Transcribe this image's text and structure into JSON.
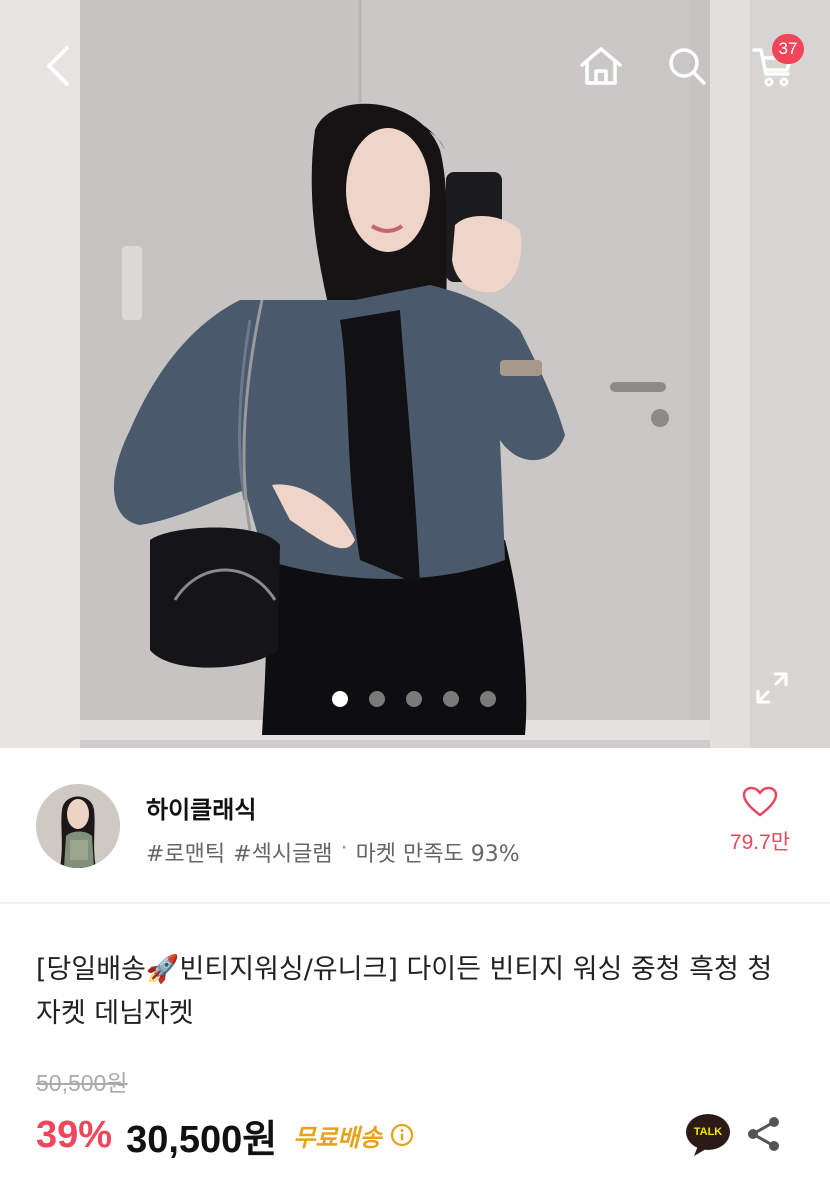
{
  "header": {
    "cart_count": "37",
    "icons": [
      "chevron-left-icon",
      "home-icon",
      "search-icon",
      "cart-icon",
      "expand-icon"
    ]
  },
  "gallery": {
    "slide_count": 5,
    "active_slide": 1
  },
  "seller": {
    "name": "하이클래식",
    "tag1": "#로맨틱",
    "tag2": "#섹시글램",
    "separator": "·",
    "satisfaction": "마켓 만족도 93%",
    "likes": "79.7만"
  },
  "product": {
    "title": "[당일배송🚀빈티지워싱/유니크] 다이든 빈티지 워싱 중청 흑청 청자켓 데님자켓",
    "original_price": "50,500원",
    "discount": "39%",
    "price": "30,500원",
    "shipping": "무료배송"
  },
  "actions": {
    "talk_label": "TALK"
  },
  "colors": {
    "accent": "#f2455a",
    "shipping": "#e8a21a",
    "like": "#e5485d"
  }
}
